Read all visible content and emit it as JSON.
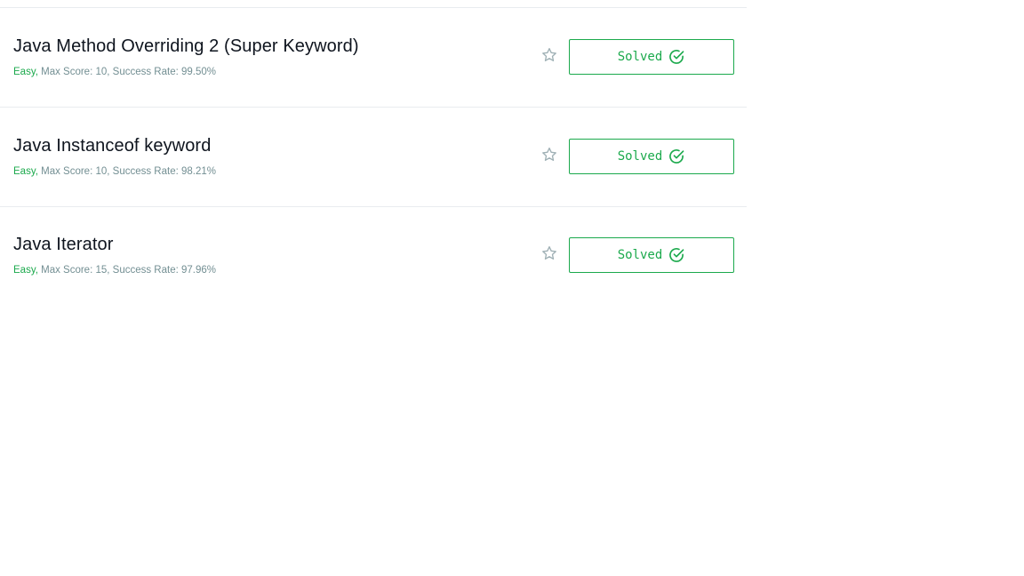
{
  "challenges": [
    {
      "title": "Java Method Overriding 2 (Super Keyword)",
      "difficulty": "Easy,",
      "details": " Max Score: 10, Success Rate: 99.50%",
      "status_label": "Solved"
    },
    {
      "title": "Java Instanceof keyword",
      "difficulty": "Easy,",
      "details": " Max Score: 10, Success Rate: 98.21%",
      "status_label": "Solved"
    },
    {
      "title": "Java Iterator",
      "difficulty": "Easy,",
      "details": " Max Score: 15, Success Rate: 97.96%",
      "status_label": "Solved"
    }
  ],
  "colors": {
    "accent_green": "#1ba94c",
    "muted_text": "#738f93",
    "title_text": "#0e141e",
    "star_outline": "#9fb0b5"
  },
  "icons": {
    "bookmark": "star-outline-icon",
    "solved": "check-circle-icon"
  }
}
